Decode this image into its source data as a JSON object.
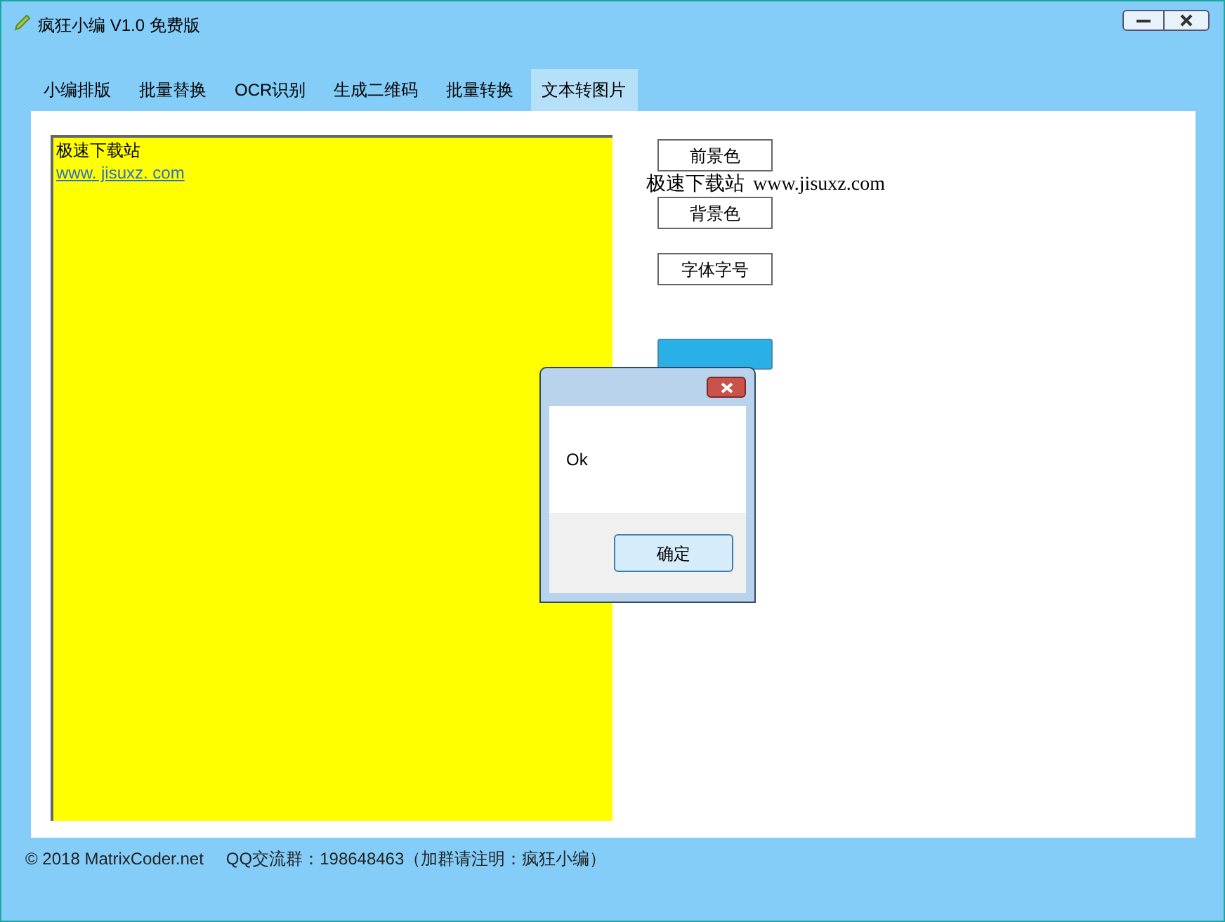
{
  "window": {
    "title": "疯狂小编 V1.0 免费版"
  },
  "tabs": [
    {
      "label": "小编排版",
      "selected": false
    },
    {
      "label": "批量替换",
      "selected": false
    },
    {
      "label": "OCR识别",
      "selected": false
    },
    {
      "label": "生成二维码",
      "selected": false
    },
    {
      "label": "批量转换",
      "selected": false
    },
    {
      "label": "文本转图片",
      "selected": true
    }
  ],
  "editor": {
    "lines": [
      {
        "kind": "text",
        "text": "极速下载站"
      },
      {
        "kind": "link",
        "text": "www. jisuxz. com"
      }
    ]
  },
  "buttons": [
    "前景色",
    "背景色",
    "字体字号"
  ],
  "preview": {
    "text_1": "极速下载站",
    "text_2": "www.jisuxz.com"
  },
  "dialog": {
    "message": "Ok",
    "button": "确定"
  },
  "status_bar": {
    "copyright": "© 2018 MatrixCoder.net",
    "contact": "QQ交流群：198648463（加群请注明：疯狂小编）"
  }
}
